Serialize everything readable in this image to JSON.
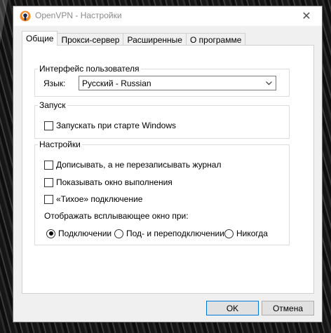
{
  "window": {
    "title": "OpenVPN - Настройки",
    "close_symbol": "✕"
  },
  "tabs": [
    {
      "label": "Общие",
      "active": true
    },
    {
      "label": "Прокси-сервер",
      "active": false
    },
    {
      "label": "Расширенные",
      "active": false
    },
    {
      "label": "О программе",
      "active": false
    }
  ],
  "interface_group": {
    "legend": "Интерфейс пользователя",
    "language_label": "Язык:",
    "language_value": "Русский - Russian"
  },
  "startup_group": {
    "legend": "Запуск",
    "start_with_windows": {
      "label": "Запускать при старте Windows",
      "checked": false
    }
  },
  "settings_group": {
    "legend": "Настройки",
    "append_log": {
      "label": "Дописывать, а не перезаписывать журнал",
      "checked": false
    },
    "show_progress": {
      "label": "Показывать окно выполнения",
      "checked": false
    },
    "silent_connect": {
      "label": "«Тихое» подключение",
      "checked": false
    },
    "popup_label": "Отображать всплывающее окно при:",
    "popup_options": [
      {
        "label": "Подключении",
        "checked": true
      },
      {
        "label": "Под- и переподключении",
        "checked": false
      },
      {
        "label": "Никогда",
        "checked": false
      }
    ]
  },
  "buttons": {
    "ok": "OK",
    "cancel": "Отмена"
  },
  "icons": {
    "app": "openvpn-icon",
    "close": "close-icon",
    "dropdown": "chevron-down-icon"
  },
  "colors": {
    "accent": "#0078d7",
    "app_icon": "#f08a24"
  }
}
